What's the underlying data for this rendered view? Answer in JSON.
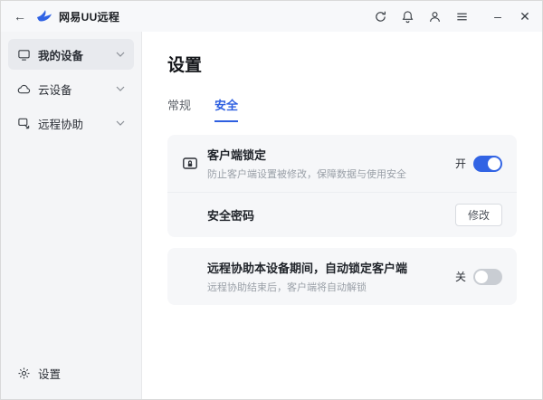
{
  "titlebar": {
    "title": "网易UU远程",
    "minimize_glyph": "–",
    "close_glyph": "✕"
  },
  "sidebar": {
    "items": [
      {
        "label": "我的设备"
      },
      {
        "label": "云设备"
      },
      {
        "label": "远程协助"
      }
    ],
    "settings_label": "设置"
  },
  "main": {
    "page_title": "设置",
    "tabs": {
      "general": "常规",
      "security": "安全"
    },
    "cards": {
      "client_lock": {
        "title": "客户端锁定",
        "description": "防止客户端设置被修改，保障数据与使用安全",
        "toggle_state": "开"
      },
      "security_password": {
        "title": "安全密码",
        "action": "修改"
      },
      "auto_lock": {
        "title": "远程协助本设备期间，自动锁定客户端",
        "description": "远程协助结束后，客户端将自动解锁",
        "toggle_state": "关"
      }
    }
  },
  "colors": {
    "accent": "#2e5fe0",
    "toggle_on": "#3264e4",
    "card_bg": "#f6f7f9"
  }
}
